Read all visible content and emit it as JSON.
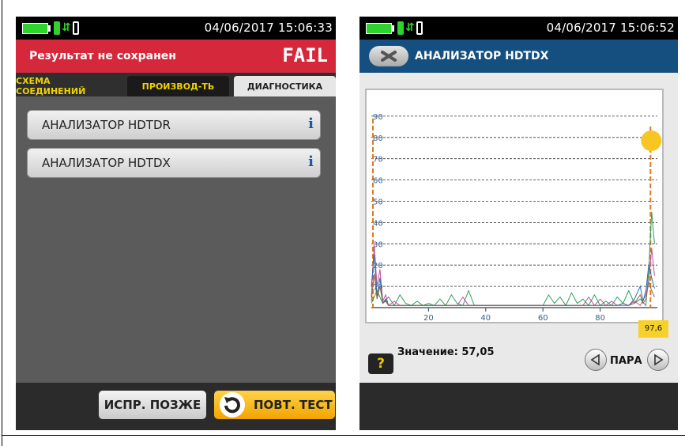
{
  "left_screen": {
    "status": {
      "datetime": "04/06/2017 15:06:33"
    },
    "result": {
      "message": "Результат не сохранен",
      "status": "FAIL"
    },
    "tabs": [
      {
        "label": "СХЕМА СОЕДИНЕНИЙ",
        "active": false
      },
      {
        "label": "ПРОИЗВОД-ТЬ",
        "active": false
      },
      {
        "label": "ДИАГНОСТИКА",
        "active": true
      }
    ],
    "items": [
      {
        "label": "АНАЛИЗАТОР HDTDR",
        "info_icon": "i"
      },
      {
        "label": "АНАЛИЗАТОР HDTDX",
        "info_icon": "i"
      }
    ],
    "buttons": {
      "fix_later": "ИСПР. ПОЗЖЕ",
      "retest": "ПОВТ. ТЕСТ"
    }
  },
  "right_screen": {
    "status": {
      "datetime": "04/06/2017 15:06:52"
    },
    "title": "АНАЛИЗАТОР HDTDX",
    "plot": {
      "y_ticks": [
        "90",
        "80",
        "70",
        "60",
        "50",
        "40",
        "30",
        "20",
        "10"
      ],
      "x_ticks": [
        "20",
        "40",
        "60",
        "80"
      ],
      "cursor_value": "97,6"
    },
    "value_text": "Значение: 57,05",
    "help_label": "?",
    "pair_label": "ПАРА"
  },
  "colors": {
    "fail_red": "#d6283b",
    "title_blue": "#154f80",
    "tab_yellow": "#f0d200",
    "retest_orange": "#f2a400",
    "limit_orange": "#e07a1c",
    "battery_green": "#2ed42b"
  },
  "icons": {
    "battery": "battery-icon",
    "link": "link-status-icon",
    "info": "info-icon",
    "retest": "retest-arrow-icon",
    "back": "back-x-icon",
    "help": "help-icon",
    "prev": "left-arrow-icon",
    "next": "right-arrow-icon"
  },
  "chart_data": {
    "type": "line",
    "y_ticks": [
      10,
      20,
      30,
      40,
      50,
      60,
      70,
      80,
      90
    ],
    "x_ticks": [
      20,
      40,
      60,
      80
    ],
    "xlim": [
      0,
      100
    ],
    "ylim": [
      0,
      100
    ],
    "cursor_x": 97.6,
    "series": [
      {
        "color": "#2f9e5d",
        "x": [
          0,
          2,
          4,
          6,
          8,
          10,
          12,
          14,
          16,
          18,
          20,
          22,
          24,
          26,
          28,
          30,
          32,
          34,
          36,
          60,
          62,
          64,
          66,
          68,
          70,
          72,
          74,
          76,
          78,
          80,
          82,
          84,
          86,
          88,
          90,
          92,
          94,
          96,
          97,
          98,
          99
        ],
        "y": [
          2,
          8,
          2,
          5,
          1,
          6,
          2,
          1,
          3,
          1,
          2,
          1,
          4,
          1,
          6,
          2,
          1,
          8,
          1,
          1,
          6,
          2,
          5,
          1,
          7,
          2,
          4,
          1,
          6,
          1,
          3,
          1,
          5,
          2,
          8,
          2,
          4,
          1,
          18,
          45,
          30
        ]
      },
      {
        "color": "#c04fa0",
        "x": [
          0,
          1,
          2,
          3,
          4,
          5,
          6,
          8,
          10,
          30,
          32,
          34,
          36,
          74,
          76,
          78,
          80,
          82,
          84,
          86,
          88,
          90,
          92,
          94,
          96,
          97,
          98,
          99
        ],
        "y": [
          5,
          30,
          10,
          18,
          3,
          6,
          1,
          3,
          1,
          1,
          5,
          1,
          1,
          1,
          5,
          1,
          4,
          1,
          3,
          1,
          2,
          1,
          3,
          1,
          6,
          12,
          28,
          15
        ]
      },
      {
        "color": "#2a6fb0",
        "x": [
          0,
          1,
          2,
          3,
          4,
          5,
          6,
          8,
          10,
          60,
          70,
          80,
          86,
          88,
          90,
          92,
          94,
          95,
          96,
          97,
          98,
          99
        ],
        "y": [
          10,
          25,
          5,
          14,
          2,
          4,
          1,
          1,
          1,
          1,
          1,
          1,
          1,
          2,
          1,
          4,
          10,
          3,
          8,
          20,
          14,
          9
        ]
      },
      {
        "color": "#8a6a3c",
        "x": [
          0,
          1,
          2,
          3,
          4,
          5,
          6,
          8,
          10,
          60,
          80,
          90,
          92,
          94,
          95,
          96,
          97,
          98,
          99
        ],
        "y": [
          3,
          16,
          4,
          10,
          2,
          3,
          1,
          1,
          1,
          1,
          1,
          1,
          2,
          6,
          2,
          4,
          12,
          8,
          5
        ]
      }
    ]
  }
}
